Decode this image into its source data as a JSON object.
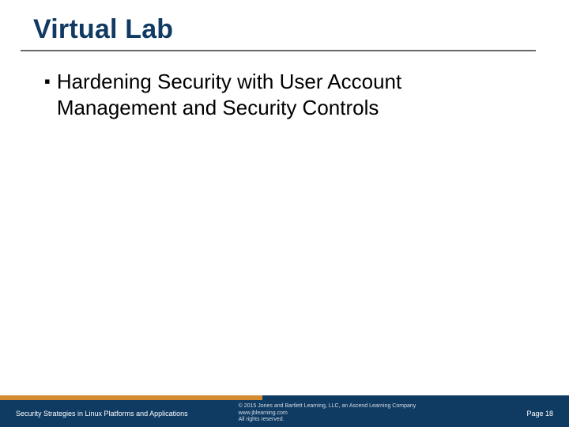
{
  "title": "Virtual Lab",
  "bullets": [
    {
      "text": "Hardening Security with User Account Management and Security Controls"
    }
  ],
  "footer": {
    "left": "Security Strategies in Linux Platforms and Applications",
    "copyright": "© 2015 Jones and Bartlett Learning, LLC, an Ascend Learning Company",
    "url": "www.jblearning.com",
    "rights": "All rights reserved.",
    "page": "Page 18"
  }
}
